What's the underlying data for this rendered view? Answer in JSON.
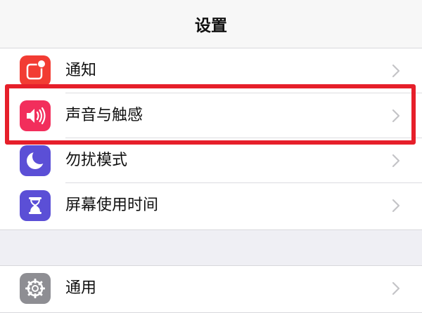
{
  "header": {
    "title": "设置"
  },
  "settings": {
    "group1": [
      {
        "label": "通知",
        "icon": "notifications-icon",
        "color": "#f23c33"
      },
      {
        "label": "声音与触感",
        "icon": "sound-icon",
        "color": "#f22e5c"
      },
      {
        "label": "勿扰模式",
        "icon": "moon-icon",
        "color": "#5b4fd6"
      },
      {
        "label": "屏幕使用时间",
        "icon": "hourglass-icon",
        "color": "#5b4fd6"
      }
    ],
    "group2": [
      {
        "label": "通用",
        "icon": "gear-icon",
        "color": "#8e8e93"
      }
    ]
  },
  "annotation": {
    "highlight_color": "#e61f2a",
    "highlighted_item": "声音与触感"
  },
  "chevron": {
    "color": "#c4c4c7",
    "icon": "chevron-right-icon"
  }
}
